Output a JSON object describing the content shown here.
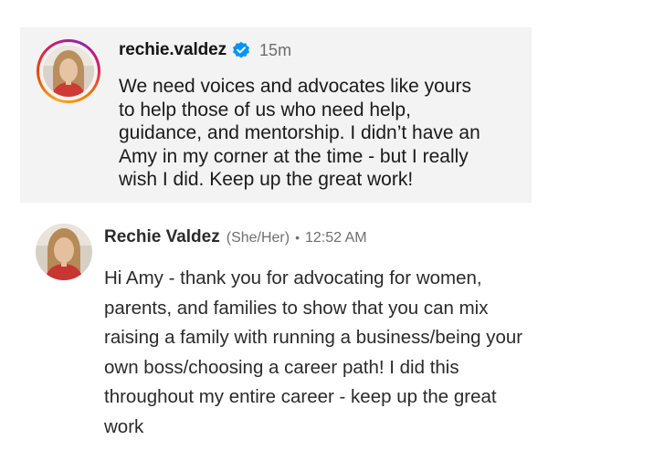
{
  "instagram_comment": {
    "username": "rechie.valdez",
    "verified_icon": "verified-badge-icon",
    "timestamp": "15m",
    "text": "We need voices and advocates like yours\nto help those of us who need help,\nguidance, and mentorship. I didn’t have an\nAmy in my corner at the time - but I really\nwish I did. Keep up the great work!",
    "colors": {
      "verified_blue": "#0095f6",
      "card_background": "#f3f3f3"
    }
  },
  "linkedin_comment": {
    "name": "Rechie Valdez",
    "pronouns": "(She/Her)",
    "separator": "•",
    "timestamp": "12:52 AM",
    "text": "Hi Amy - thank you for advocating for women,\nparents, and families to show that you can mix\nraising a family with running a business/being your\nown boss/choosing a career path! I did this\nthroughout my entire career - keep up the great\nwork"
  }
}
